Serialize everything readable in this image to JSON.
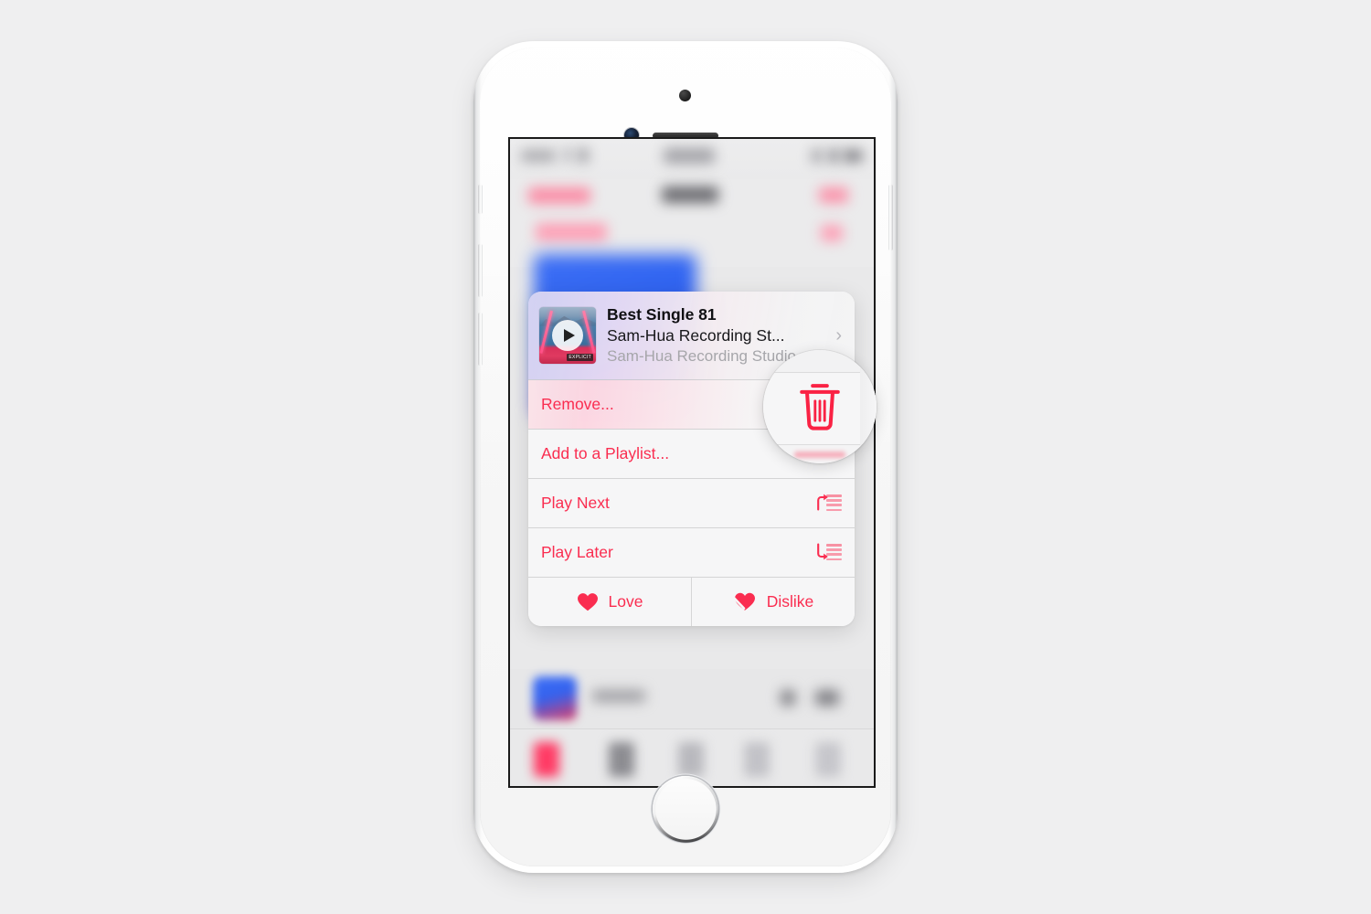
{
  "device": {
    "name": "iPhone",
    "color": "silver-white",
    "hardware": {
      "earpiece": "earpiece-speaker",
      "front_camera": "front-camera",
      "proximity_sensor": "proximity-sensor",
      "home_button": "home-button",
      "ringer_switch": "ringer-switch",
      "volume_up": "volume-up-button",
      "volume_down": "volume-down-button",
      "power": "power-button"
    }
  },
  "colors": {
    "accent_red": "#fa2d50",
    "title_text": "#101013",
    "secondary_text": "#a6a6aa",
    "card_background": "#f4f4f5",
    "screen_background": "#e9e9ea"
  },
  "context_menu": {
    "header": {
      "title": "Best Single 81",
      "subtitle": "Sam-Hua Recording St...",
      "caption": "Sam-Hua Recording Studio",
      "chevron": "›",
      "artwork": {
        "name": "album-artwork",
        "explicit_badge": "EXPLICIT",
        "overlay": "play-button"
      }
    },
    "items": [
      {
        "label": "Remove...",
        "icon": "trash-icon",
        "name": "menu-item-remove",
        "highlighted": true
      },
      {
        "label": "Add to a Playlist...",
        "icon": "plus-icon",
        "name": "menu-item-add-to-playlist",
        "highlighted": false
      },
      {
        "label": "Play Next",
        "icon": "play-next-icon",
        "name": "menu-item-play-next",
        "highlighted": false
      },
      {
        "label": "Play Later",
        "icon": "play-later-icon",
        "name": "menu-item-play-later",
        "highlighted": false
      }
    ],
    "rating": [
      {
        "label": "Love",
        "icon": "heart-icon",
        "name": "menu-item-love"
      },
      {
        "label": "Dislike",
        "icon": "broken-heart-icon",
        "name": "menu-item-dislike"
      }
    ]
  },
  "magnifier": {
    "name": "magnifier-callout",
    "magnified_icon": "trash-icon",
    "description": "Zoomed view of the Remove row trash icon"
  }
}
